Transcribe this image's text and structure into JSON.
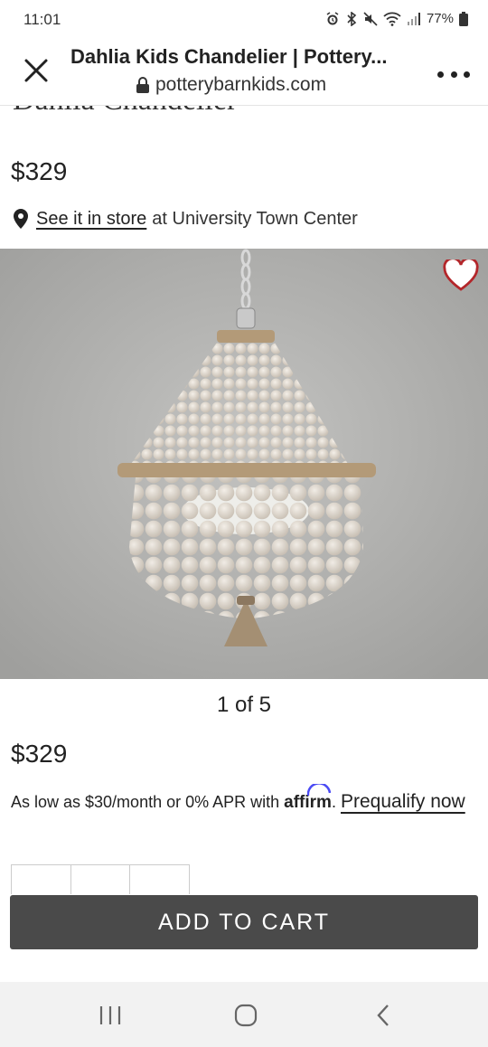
{
  "status_bar": {
    "time": "11:01",
    "battery": "77%",
    "icons": [
      "alarm-icon",
      "bluetooth-icon",
      "mute-icon",
      "wifi-icon",
      "signal-icon",
      "battery-icon"
    ]
  },
  "browser": {
    "tab_title": "Dahlia Kids Chandelier | Pottery...",
    "url": "potterybarnkids.com"
  },
  "product": {
    "clipped_title": "Dahlia Chandelier",
    "price_top": "$329",
    "store_link": "See it in store",
    "store_suffix": "at University Town Center",
    "image_counter": "1 of 5",
    "price_main": "$329",
    "financing_text": "As low as $30/month or 0% APR with",
    "affirm_logo": "affirm",
    "prequalify_link": "Prequalify now",
    "add_to_cart": "ADD TO CART"
  },
  "colors": {
    "accent_button": "#4a4a4a",
    "heart": "#b3262a",
    "affirm": "#4a4af4",
    "image_bg": "#b4b4b2"
  }
}
